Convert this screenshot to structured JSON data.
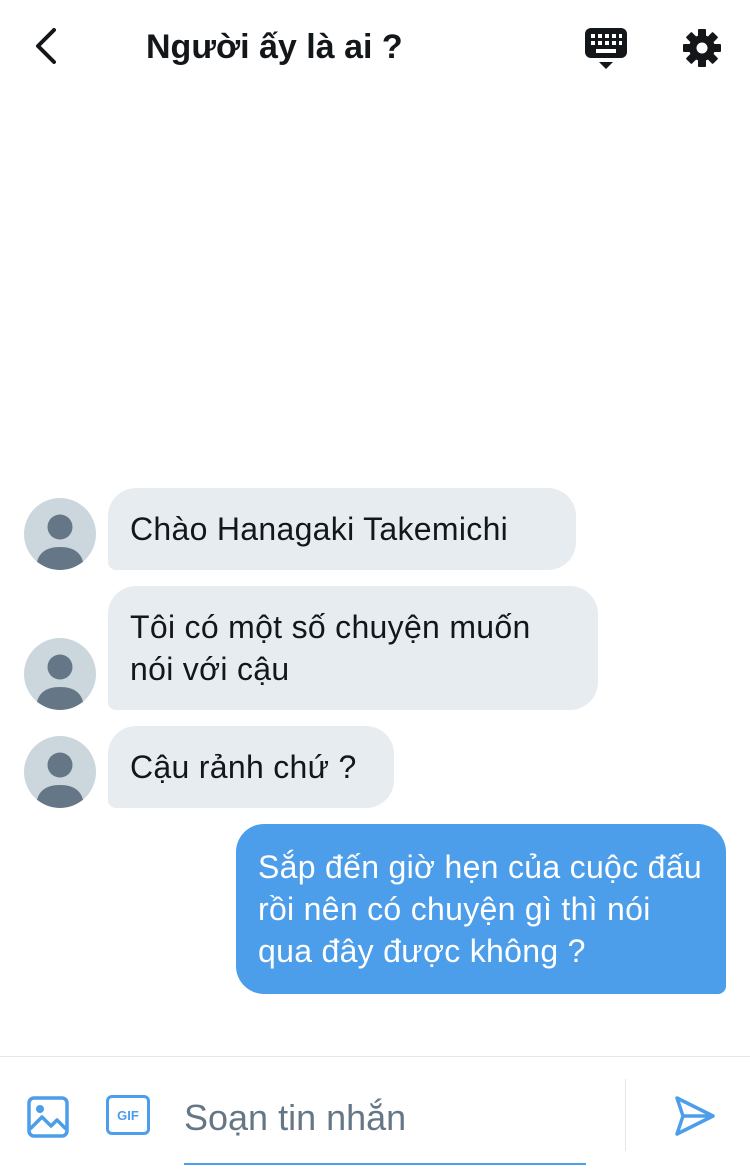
{
  "header": {
    "title": "Người ấy là ai ?",
    "back_icon": "chevron-left-icon",
    "keyboard_icon": "keyboard-icon",
    "settings_icon": "gear-icon"
  },
  "messages": [
    {
      "direction": "incoming",
      "text": "Chào Hanagaki Takemichi"
    },
    {
      "direction": "incoming",
      "text": "Tôi có một số chuyện muốn nói với cậu"
    },
    {
      "direction": "incoming",
      "text": "Cậu rảnh chứ ?"
    },
    {
      "direction": "outgoing",
      "text": "Sắp đến giờ hẹn của cuộc đấu rồi nên có chuyện gì thì nói qua đây được không ?"
    }
  ],
  "composer": {
    "placeholder": "Soạn tin nhắn",
    "value": "",
    "gif_label": "GIF",
    "image_icon": "image-icon",
    "send_icon": "send-icon"
  },
  "colors": {
    "accent": "#4c9eeb",
    "incoming_bubble": "#e6ecf0",
    "avatar": "#ccd6dd",
    "avatar_figure": "#657786",
    "text": "#14171a"
  }
}
